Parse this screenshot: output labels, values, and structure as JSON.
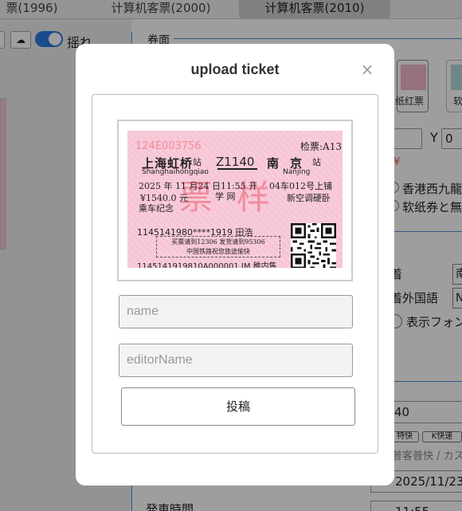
{
  "tabs": [
    {
      "label": "票(1996)"
    },
    {
      "label": "计算机客票(2000)"
    },
    {
      "label": "计算机客票(2010)"
    }
  ],
  "sidebar": {
    "toggle_label": "摇れ"
  },
  "panel": {
    "section_title": "券面",
    "thumb1_caption": "纸红票",
    "thumb2_caption": "软",
    "y_label": "Y",
    "y_value": "0",
    "red_mark": "¥",
    "radio1_label": "香港西九龍",
    "radio2_label": "软纸券と無",
    "label_a": "着",
    "select_a": "南",
    "label_b": "着外国語",
    "select_b": "N",
    "radio3_label": "表示フォン",
    "train_value": "40",
    "chip1": "特快",
    "chip2": "K快速",
    "hint": "普客普快 / カス",
    "date_value": "2025/11/23",
    "time_label": "発車時間",
    "time_value": "11:55"
  },
  "modal": {
    "title": "upload ticket",
    "close_icon": "×",
    "name_placeholder": "name",
    "editor_placeholder": "editorName",
    "submit_label": "投稿"
  },
  "ticket": {
    "serial": "124E003756",
    "check": "检票:A13",
    "from": "上海虹桥",
    "from_suffix": "站",
    "train": "Z1140",
    "to": "南京",
    "to_suffix": "站",
    "from_en": "Shanghaihongqiao",
    "to_en": "Nanjing",
    "date": "2025 年 11 月24 日11:55 开",
    "seat": "04车012号上铺",
    "price": "¥1540.0 元",
    "icons": "学 网",
    "seat_type": "新空调硬卧",
    "memo": "乘车纪念",
    "sample": "票样",
    "id_name": "1145141980****1919 田浩",
    "notice_line1": "买票请到12306 发货请到95306",
    "notice_line2": "中国铁路祝您旅途愉快",
    "bottom": "1145141919810A000001 JM  稚内售"
  }
}
